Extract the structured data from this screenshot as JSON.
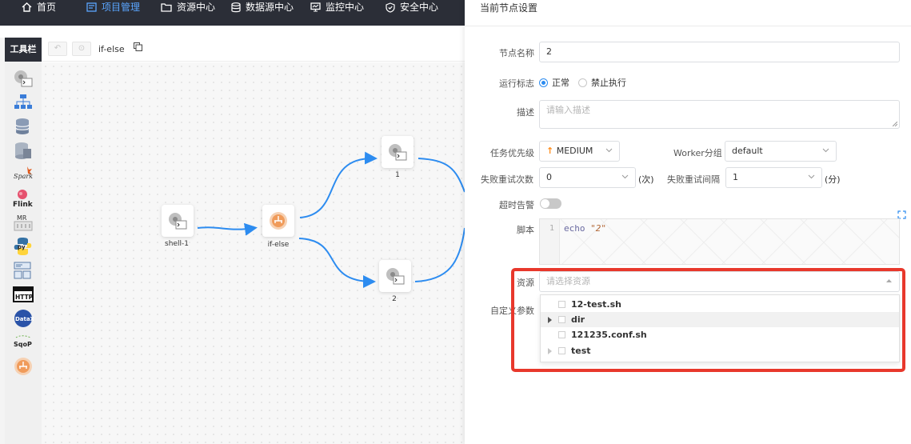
{
  "nav": {
    "items": [
      {
        "label": "首页",
        "icon": "home-icon",
        "active": false
      },
      {
        "label": "项目管理",
        "icon": "project-icon",
        "active": true
      },
      {
        "label": "资源中心",
        "icon": "folder-icon",
        "active": false
      },
      {
        "label": "数据源中心",
        "icon": "database-icon",
        "active": false
      },
      {
        "label": "监控中心",
        "icon": "monitor-icon",
        "active": false
      },
      {
        "label": "安全中心",
        "icon": "shield-icon",
        "active": false
      }
    ]
  },
  "canvas": {
    "toolbar_label": "工具栏",
    "workflow_name": "if-else",
    "nodes": [
      {
        "label": "shell-1",
        "type": "shell"
      },
      {
        "label": "if-else",
        "type": "conditions"
      },
      {
        "label": "1",
        "type": "shell"
      },
      {
        "label": "2",
        "type": "shell"
      }
    ],
    "tools": [
      "shell-icon",
      "sub-process-icon",
      "procedure-icon",
      "sql-icon",
      "spark-icon",
      "flink-icon",
      "mr-icon",
      "python-icon",
      "dependent-icon",
      "http-icon",
      "datax-icon",
      "sqoop-icon",
      "conditions-icon"
    ],
    "tool_labels": {
      "spark": "Spark",
      "flink": "Flink",
      "mr": "MR",
      "python": "py",
      "http": "HTTP",
      "datax": "DataX",
      "sqoop": "SqoP"
    }
  },
  "panel": {
    "title": "当前节点设置",
    "node_name_label": "节点名称",
    "node_name_value": "2",
    "run_flag_label": "运行标志",
    "run_flag_options": [
      "正常",
      "禁止执行"
    ],
    "run_flag_selected": "正常",
    "desc_label": "描述",
    "desc_placeholder": "请输入描述",
    "priority_label": "任务优先级",
    "priority_value": "MEDIUM",
    "priority_color": "#ff8c1a",
    "worker_group_label": "Worker分组",
    "worker_group_value": "default",
    "fail_retry_times_label": "失败重试次数",
    "fail_retry_times_value": "0",
    "fail_retry_times_unit": "(次)",
    "fail_retry_interval_label": "失败重试间隔",
    "fail_retry_interval_value": "1",
    "fail_retry_interval_unit": "(分)",
    "timeout_alarm_label": "超时告警",
    "timeout_alarm_enabled": false,
    "script_label": "脚本",
    "script_line_number": "1",
    "script_keyword": "echo",
    "script_string": "\"2\"",
    "resources_label": "资源",
    "resources_placeholder": "请选择资源",
    "custom_params_label": "自定义参数",
    "resource_tree": [
      {
        "label": "12-test.sh",
        "expandable": false
      },
      {
        "label": "dir",
        "expandable": true
      },
      {
        "label": "121235.conf.sh",
        "expandable": false
      },
      {
        "label": "test",
        "expandable": true
      }
    ]
  },
  "colors": {
    "nav_bg": "#2b2e37",
    "nav_active": "#5aa5ff",
    "edge": "#2d8cf0",
    "highlight": "#e8382c"
  }
}
